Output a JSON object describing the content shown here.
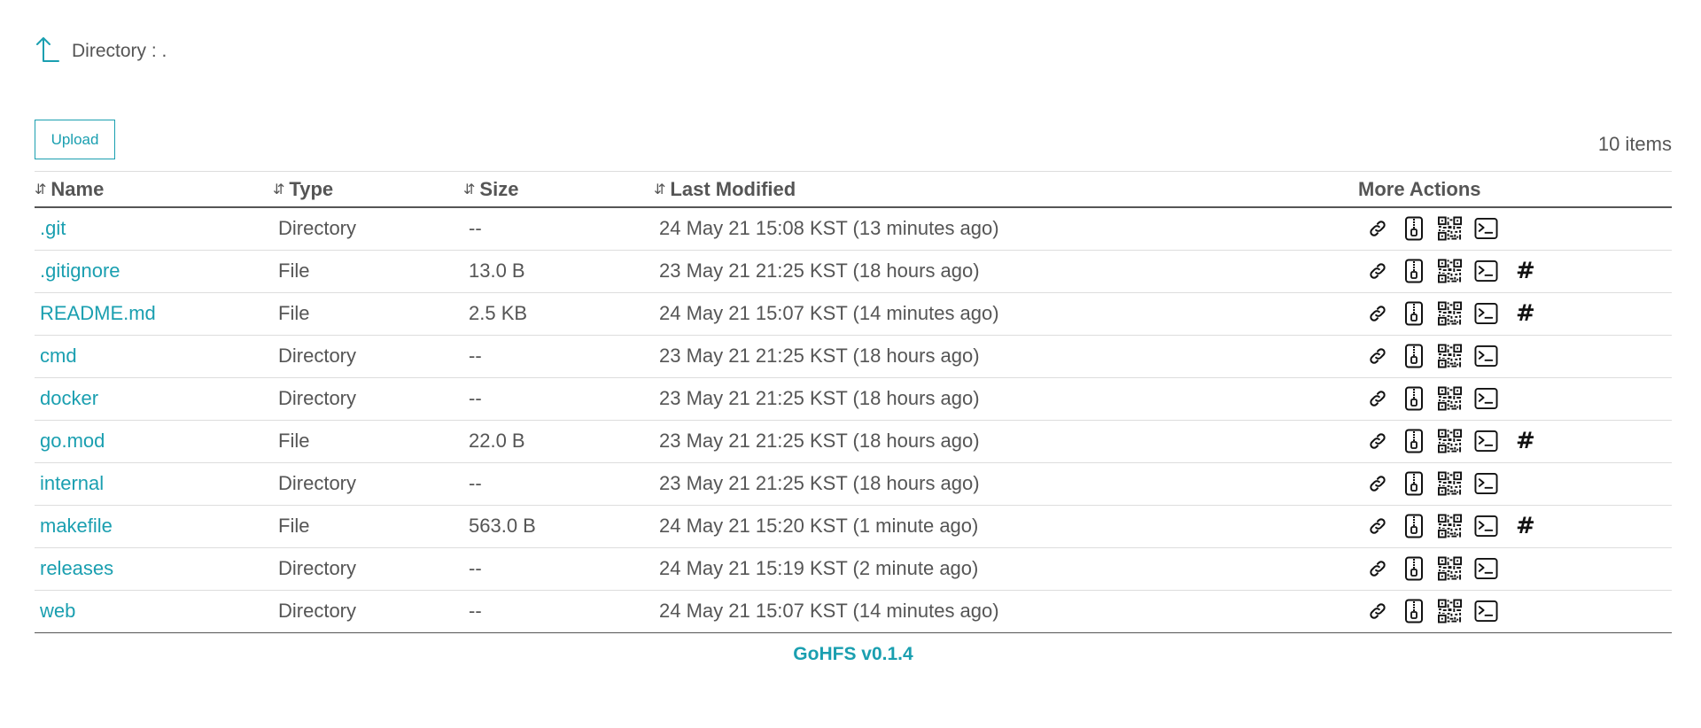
{
  "header": {
    "directory_label": "Directory : ."
  },
  "toolbar": {
    "upload_label": "Upload",
    "item_count": "10 items"
  },
  "table": {
    "columns": {
      "name": "Name",
      "type": "Type",
      "size": "Size",
      "modified": "Last Modified",
      "actions": "More Actions"
    },
    "rows": [
      {
        "name": ".git",
        "type": "Directory",
        "size": "--",
        "modified": "24 May 21 15:08 KST (13 minutes ago)",
        "hash": false
      },
      {
        "name": ".gitignore",
        "type": "File",
        "size": "13.0 B",
        "modified": "23 May 21 21:25 KST (18 hours ago)",
        "hash": true
      },
      {
        "name": "README.md",
        "type": "File",
        "size": "2.5 KB",
        "modified": "24 May 21 15:07 KST (14 minutes ago)",
        "hash": true
      },
      {
        "name": "cmd",
        "type": "Directory",
        "size": "--",
        "modified": "23 May 21 21:25 KST (18 hours ago)",
        "hash": false
      },
      {
        "name": "docker",
        "type": "Directory",
        "size": "--",
        "modified": "23 May 21 21:25 KST (18 hours ago)",
        "hash": false
      },
      {
        "name": "go.mod",
        "type": "File",
        "size": "22.0 B",
        "modified": "23 May 21 21:25 KST (18 hours ago)",
        "hash": true
      },
      {
        "name": "internal",
        "type": "Directory",
        "size": "--",
        "modified": "23 May 21 21:25 KST (18 hours ago)",
        "hash": false
      },
      {
        "name": "makefile",
        "type": "File",
        "size": "563.0 B",
        "modified": "24 May 21 15:20 KST (1 minute ago)",
        "hash": true
      },
      {
        "name": "releases",
        "type": "Directory",
        "size": "--",
        "modified": "24 May 21 15:19 KST (2 minute ago)",
        "hash": false
      },
      {
        "name": "web",
        "type": "Directory",
        "size": "--",
        "modified": "24 May 21 15:07 KST (14 minutes ago)",
        "hash": false
      }
    ],
    "row_action_icons": [
      "link-icon",
      "zip-archive-icon",
      "qr-code-icon",
      "terminal-icon"
    ],
    "hash_symbol": "#",
    "sort_symbol": "⇵"
  },
  "footer": {
    "version": "GoHFS v0.1.4"
  },
  "colors": {
    "accent": "#1a9fb0",
    "text": "#555555"
  }
}
